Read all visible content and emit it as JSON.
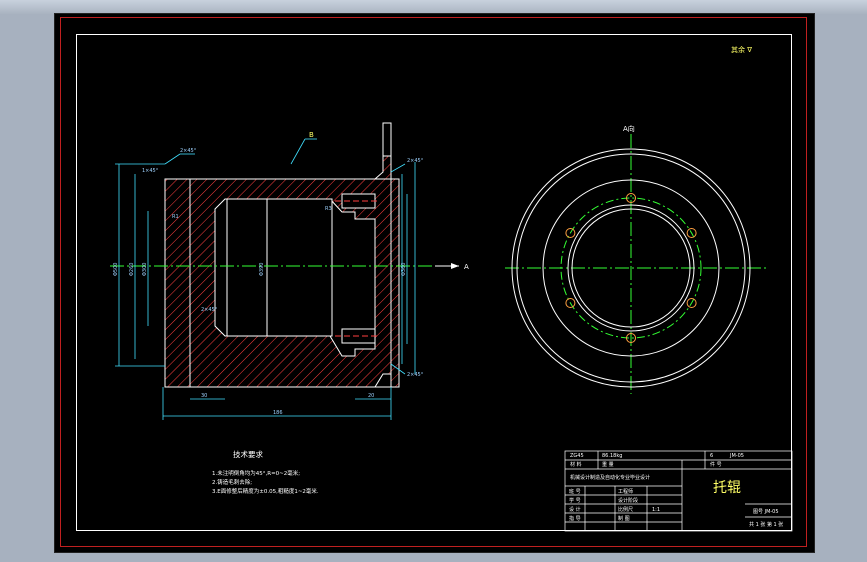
{
  "drawing": {
    "corner_note": "其余 ∇",
    "view_label": "A向",
    "section_label": "B",
    "section_arrow": "A",
    "tech_title": "技术要求",
    "tech_items": [
      "1.未注明倒角均为45°,R=0~2毫米;",
      "2.铸造毛刺去除;",
      "3.E面修整后精度为±0.05,粗糙度1~2毫米."
    ],
    "dims_left": {
      "chamfer_top": "2×45°",
      "chamfer_mid": "2×45°",
      "chamfer_right": "2×45°",
      "chamfer_bottom": "2×45°",
      "chamfer_small": "1×45°",
      "d1": "Φ500",
      "d2": "Φ260",
      "d3": "Φ300",
      "d4": "Φ390",
      "d5": "Φ360",
      "len_total": "186",
      "len_a": "30",
      "len_b": "20",
      "r1": "R1",
      "r2": "R3"
    }
  },
  "title_block": {
    "part_name": "托辊",
    "material": "ZG45",
    "weight": "86.18kg",
    "count": "6",
    "drawing_no": "JM-05",
    "row_material": "材 料",
    "row_weight": "重 量",
    "row_count": "件 号",
    "row_sheet": "共 张 第 张",
    "project": "机械设计制造及自动化专业毕业设计",
    "role1": "班 号",
    "role2": "学 号",
    "role3": "设 计",
    "role4": "指 导",
    "val1": "工程师",
    "val2": "设计阶段",
    "val3": "比例尺",
    "val4": "制 图",
    "scale": "1:1",
    "code": "图号 JM-05",
    "sheet": "共 1 张 第 1 张"
  }
}
